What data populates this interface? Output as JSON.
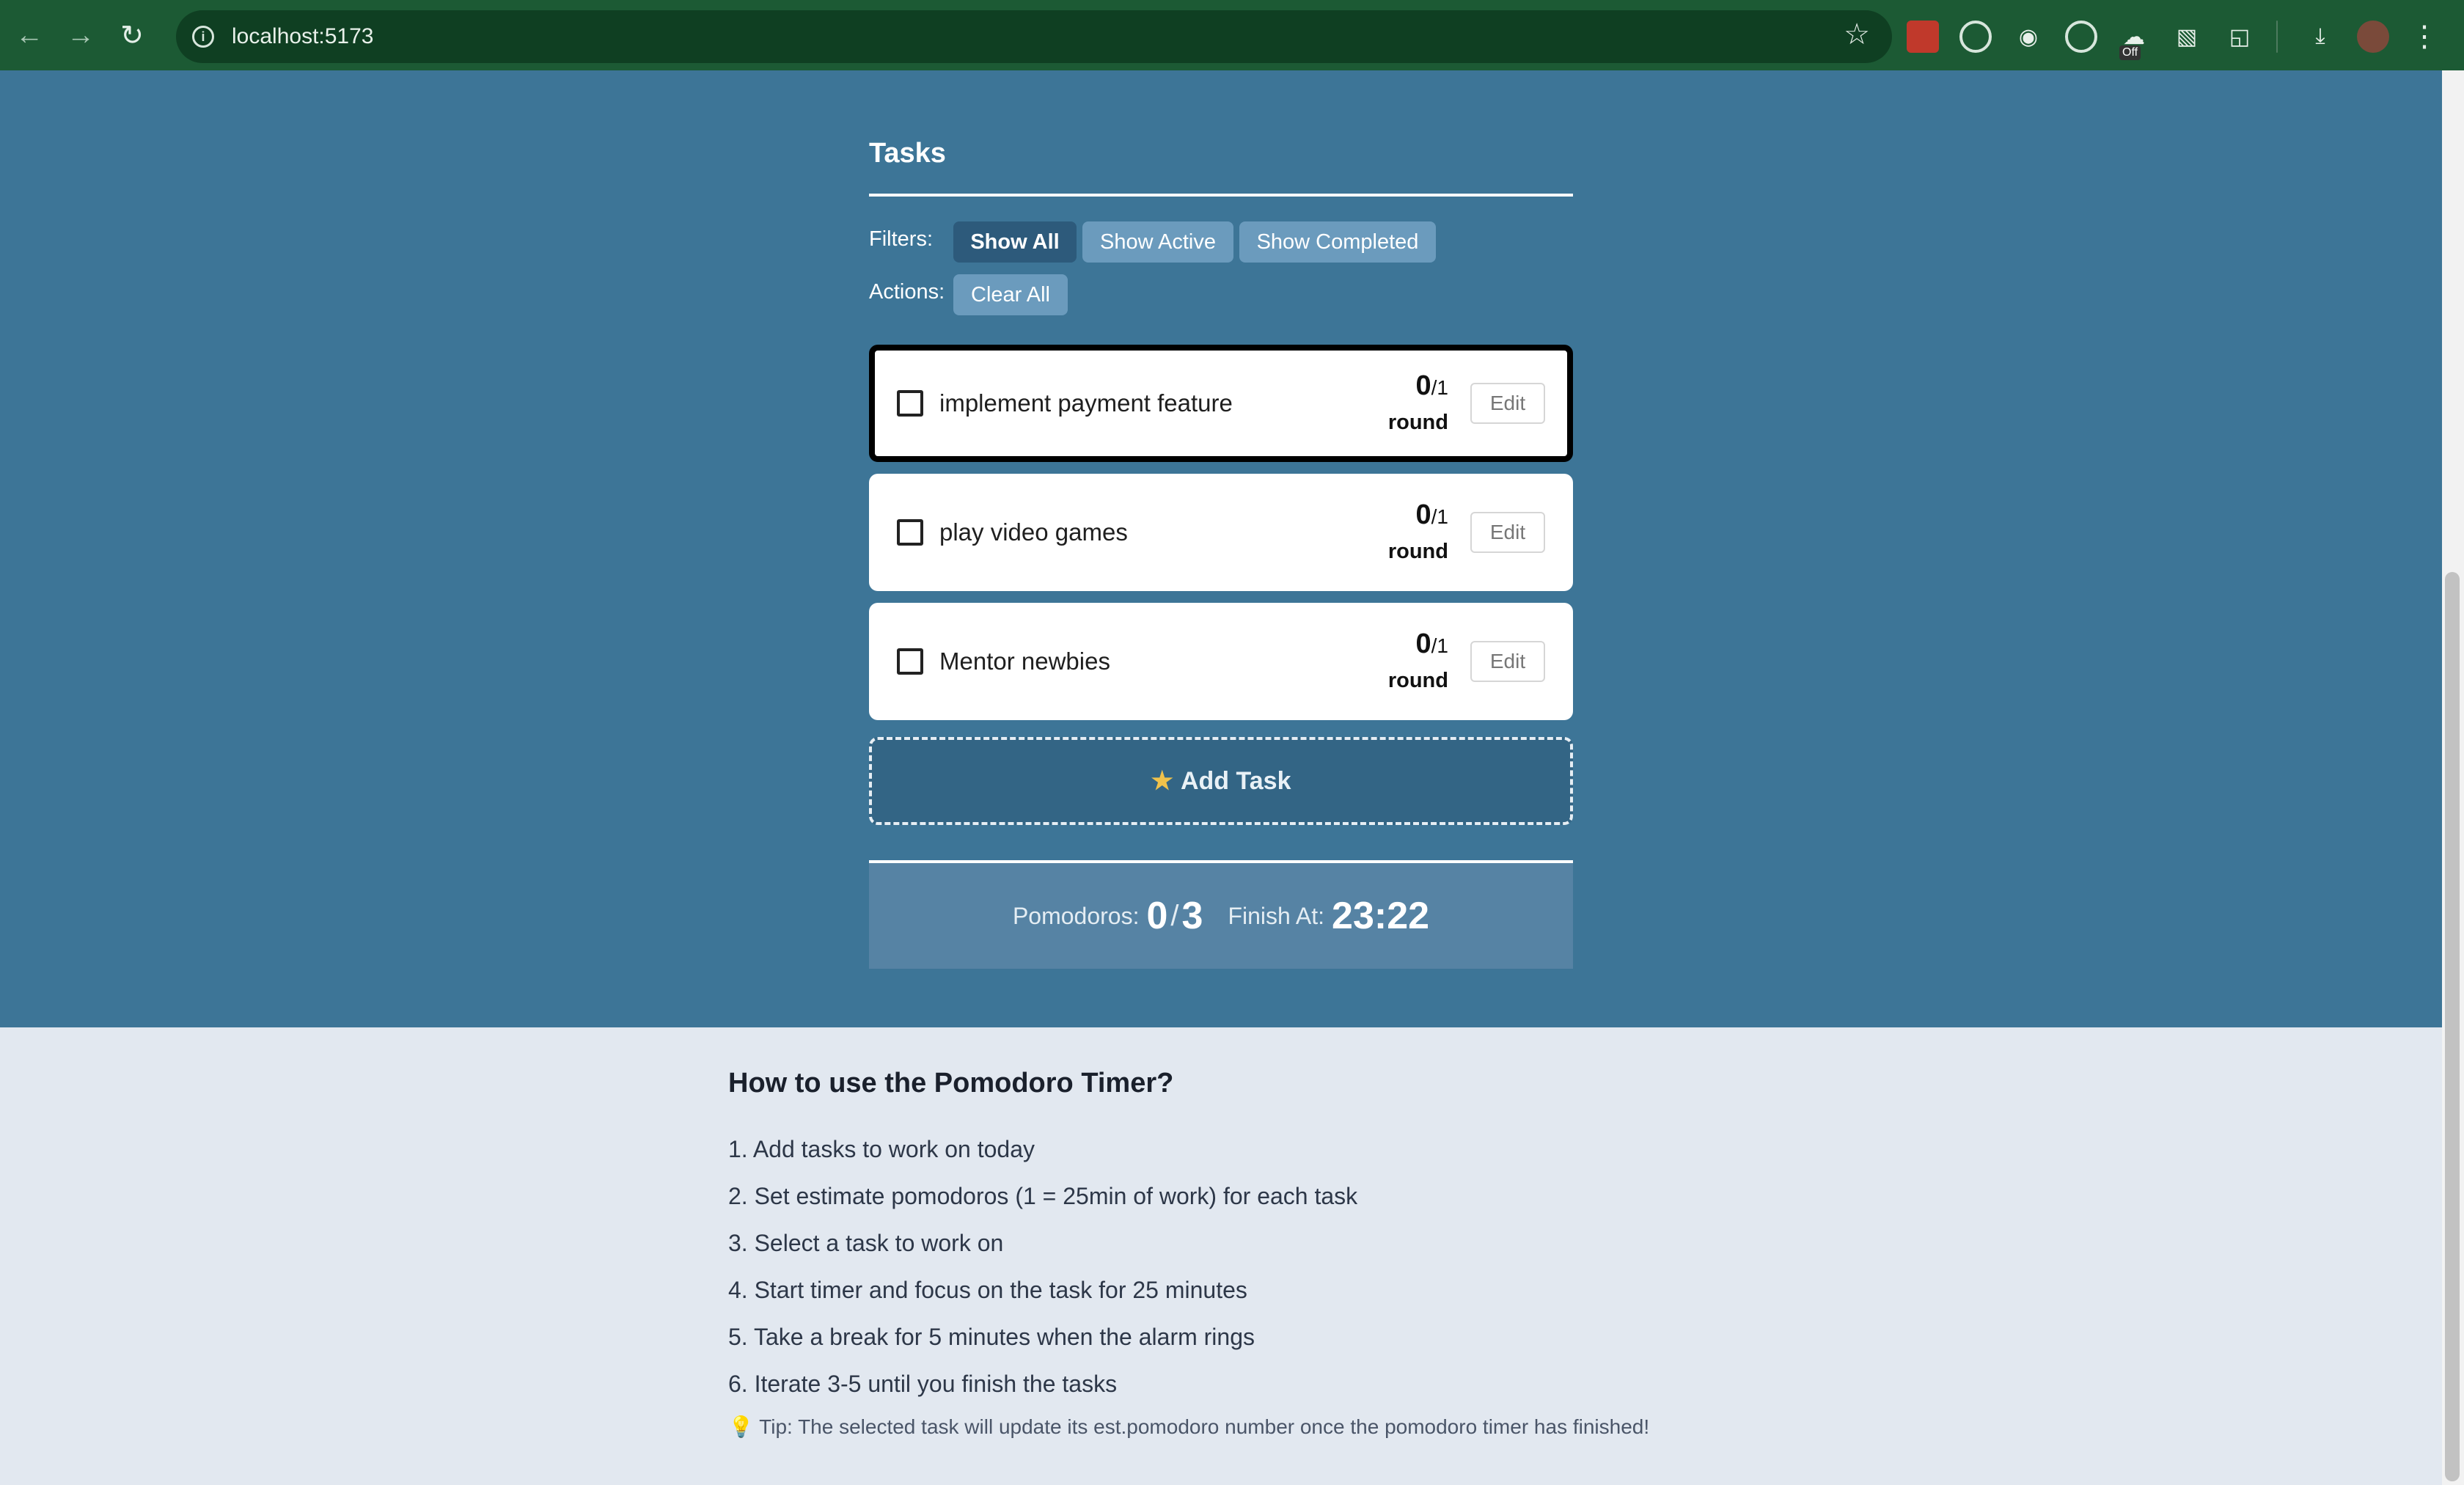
{
  "browser": {
    "url": "localhost:5173",
    "icons": [
      "back-icon",
      "forward-icon",
      "reload-icon",
      "site-info-icon",
      "bookmark-star-icon",
      "extensions-icon",
      "download-icon",
      "menu-icon"
    ],
    "ext_off_badge": "Off"
  },
  "tasks": {
    "header": "Tasks",
    "filters_label": "Filters:",
    "filters": [
      "Show All",
      "Show Active",
      "Show Completed"
    ],
    "active_filter": "Show All",
    "actions_label": "Actions:",
    "clear_all": "Clear All",
    "items": [
      {
        "name": "implement payment feature",
        "done": "0",
        "est": "/1",
        "unit": "round",
        "edit": "Edit",
        "selected": true,
        "checked": false
      },
      {
        "name": "play video games",
        "done": "0",
        "est": "/1",
        "unit": "round",
        "edit": "Edit",
        "selected": false,
        "checked": false
      },
      {
        "name": "Mentor newbies",
        "done": "0",
        "est": "/1",
        "unit": "round",
        "edit": "Edit",
        "selected": false,
        "checked": false
      }
    ],
    "add_task": "Add Task"
  },
  "summary": {
    "pomodoros_label": "Pomodoros:",
    "pomodoros_done": "0",
    "slash": "/",
    "pomodoros_total": "3",
    "finish_label": "Finish At:",
    "finish_time": "23:22"
  },
  "howto": {
    "title": "How to use the Pomodoro Timer?",
    "steps": [
      "1. Add tasks to work on today",
      "2. Set estimate pomodoros (1 = 25min of work) for each task",
      "3. Select a task to work on",
      "4. Start timer and focus on the task for 25 minutes",
      "5. Take a break for 5 minutes when the alarm rings",
      "6. Iterate 3-5 until you finish the tasks"
    ],
    "tip": "Tip: The selected task will update its est.pomodoro number once the pomodoro timer has finished!"
  },
  "colors": {
    "app_background": "#3d7597",
    "page_background": "#e2e8f0",
    "active_filter": "#2d5a7b",
    "filter_pill": "#6b9bbd",
    "summary_background": "#5683a4"
  }
}
